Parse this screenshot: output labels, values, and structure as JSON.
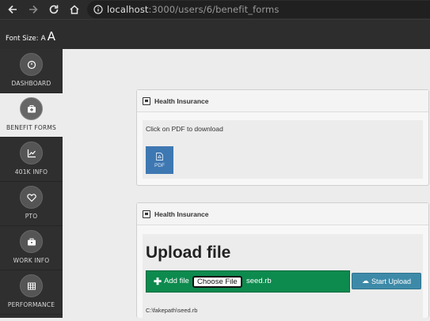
{
  "browser": {
    "url_host": "localhost",
    "url_rest": ":3000/users/6/benefit_forms"
  },
  "header": {
    "font_size_label": "Font Size:",
    "font_small": "A",
    "font_large": "A"
  },
  "sidebar": {
    "items": [
      {
        "label": "DASHBOARD",
        "icon": "dashboard-icon"
      },
      {
        "label": "BENEFIT FORMS",
        "icon": "medical-kit-icon",
        "active": true
      },
      {
        "label": "401K INFO",
        "icon": "chart-icon"
      },
      {
        "label": "PTO",
        "icon": "heart-icon"
      },
      {
        "label": "WORK INFO",
        "icon": "briefcase-icon"
      },
      {
        "label": "PERFORMANCE",
        "icon": "table-icon"
      }
    ]
  },
  "panel1": {
    "title": "Health Insurance",
    "instruction": "Click on PDF to download",
    "pdf_label": "PDF"
  },
  "panel2": {
    "title": "Health Insurance",
    "upload_title": "Upload file",
    "add_file_label": "Add file",
    "choose_file_label": "Choose File",
    "chosen_file": "seed.rb",
    "start_upload_label": "Start Upload",
    "file_path": "C:\\fakepath\\seed.rb"
  },
  "colors": {
    "upload_green": "#0d8a4e",
    "start_upload_blue": "#3d8aa8",
    "pdf_blue": "#3e78b2"
  }
}
